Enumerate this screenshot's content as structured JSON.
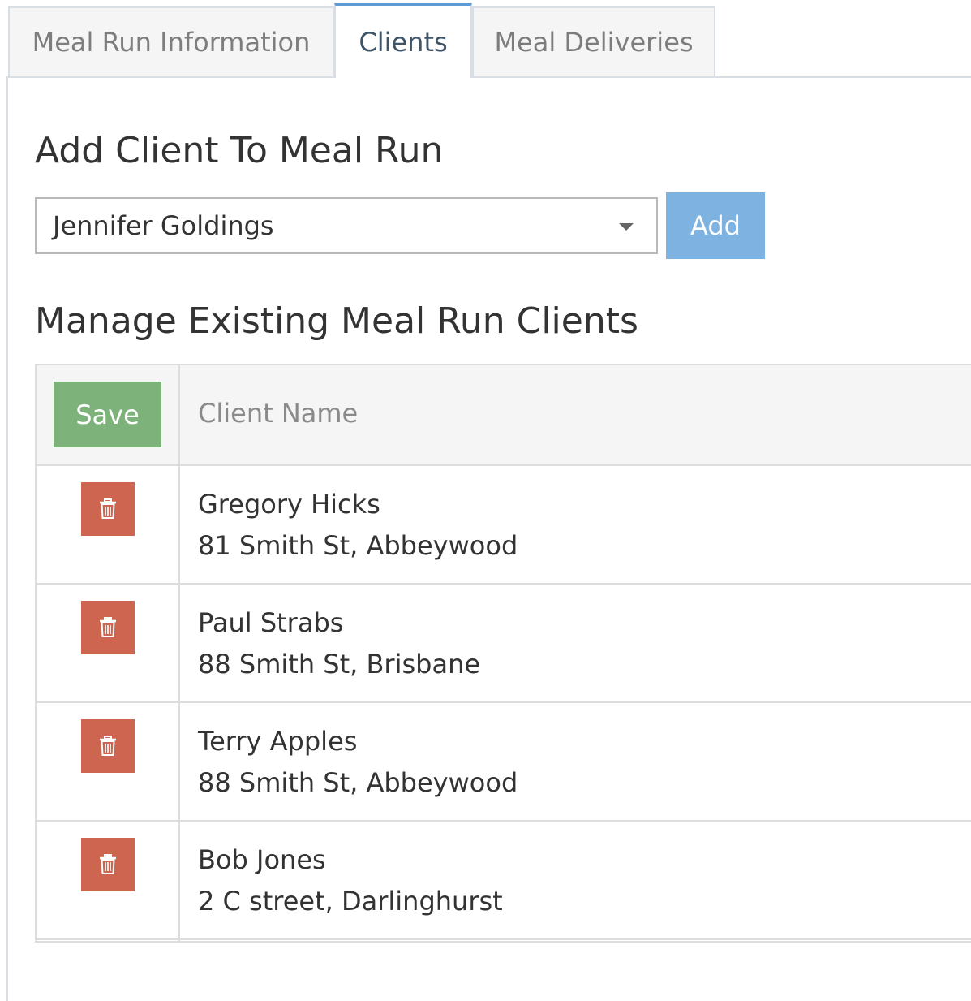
{
  "tabs": [
    {
      "label": "Meal Run Information",
      "active": false
    },
    {
      "label": "Clients",
      "active": true
    },
    {
      "label": "Meal Deliveries",
      "active": false
    }
  ],
  "add_section": {
    "heading": "Add Client To Meal Run",
    "selected_client": "Jennifer Goldings",
    "add_label": "Add"
  },
  "manage_section": {
    "heading": "Manage Existing Meal Run Clients",
    "save_label": "Save",
    "column_header": "Client Name"
  },
  "clients": [
    {
      "name": "Gregory Hicks",
      "address": "81 Smith St, Abbeywood"
    },
    {
      "name": "Paul Strabs",
      "address": "88 Smith St, Brisbane"
    },
    {
      "name": "Terry Apples",
      "address": "88 Smith St, Abbeywood"
    },
    {
      "name": "Bob Jones",
      "address": "2 C street, Darlinghurst"
    }
  ],
  "colors": {
    "accent_blue": "#7eb2e0",
    "save_green": "#7db37a",
    "delete_red": "#cd6550",
    "active_tab_border": "#5d9ad6"
  },
  "icons": {
    "delete": "trash-icon",
    "dropdown": "chevron-down-icon"
  }
}
